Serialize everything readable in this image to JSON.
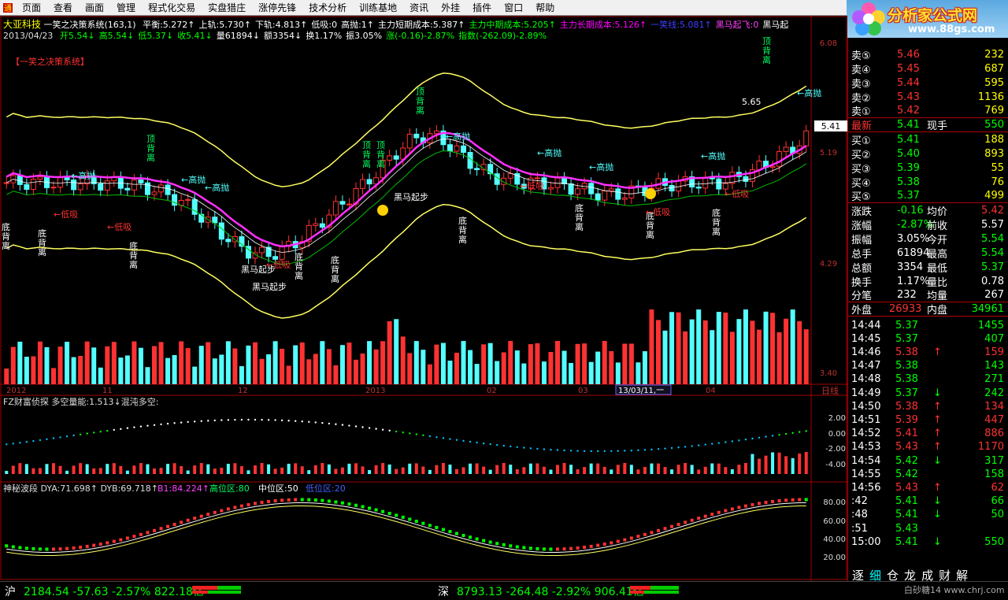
{
  "menu": [
    "页面",
    "查看",
    "画面",
    "管理",
    "程式化交易",
    "实盘猎庄",
    "涨停先锋",
    "技术分析",
    "训练基地",
    "资讯",
    "外挂",
    "插件",
    "窗口",
    "帮助"
  ],
  "banner": {
    "title": "分析家公式网",
    "url": "www.88gs.com"
  },
  "header": {
    "stock_name": "大亚科技",
    "formula": "一笑之决策系统(163,1)",
    "indicators": [
      {
        "text": "平衡:5.272↑",
        "color": "#ffffff"
      },
      {
        "text": "上轨:5.730↑",
        "color": "#ffffff"
      },
      {
        "text": "下轨:4.813↑",
        "color": "#ffffff"
      },
      {
        "text": "低吸:0",
        "color": "#ffffff"
      },
      {
        "text": "高抛:1↑",
        "color": "#ffffff"
      },
      {
        "text": "主力短期成本:5.387↑",
        "color": "#ffffff"
      },
      {
        "text": "主力中期成本:5.205↑",
        "color": "#00ff00"
      },
      {
        "text": "主力长期成本:5.126↑",
        "color": "#ff00ff"
      },
      {
        "text": "一笑线:5.081↑",
        "color": "#4040ff"
      },
      {
        "text": "黑马起飞:0",
        "color": "#ff40ff"
      },
      {
        "text": "黑马起",
        "color": "#ffffff"
      }
    ],
    "date": "2013/04/23",
    "ohlc": [
      {
        "text": "开5.54↓",
        "color": "#00ff00"
      },
      {
        "text": "高5.54↓",
        "color": "#00ff00"
      },
      {
        "text": "低5.37↓",
        "color": "#00ff00"
      },
      {
        "text": "收5.41↓",
        "color": "#00ff00"
      },
      {
        "text": "量61894↓",
        "color": "#ffffff"
      },
      {
        "text": "额3354↓",
        "color": "#ffffff"
      },
      {
        "text": "换1.17%",
        "color": "#ffffff"
      },
      {
        "text": "振3.05%",
        "color": "#ffffff"
      },
      {
        "text": "涨(-0.16)-2.87%",
        "color": "#00ff00"
      },
      {
        "text": "指数(-262.09)-2.89%",
        "color": "#00ff00"
      }
    ],
    "system_tag": "【一笑之决策系统】"
  },
  "axis": {
    "price_ticks": [
      "6.08",
      "5.19",
      "4.29",
      "3.40"
    ],
    "current_price": "5.41",
    "time_labels": [
      "2012",
      "11",
      "12",
      "2013",
      "02",
      "03",
      "13/03/11,一",
      "04"
    ],
    "period_label": "日线",
    "sub1_ticks": [
      "2.00",
      "0.00",
      "-2.00",
      "-4.00"
    ],
    "sub2_ticks": [
      "80.00",
      "60.00",
      "40.00",
      "20.00"
    ]
  },
  "sub1": {
    "title": "FZ财富侦探",
    "text": "多空量能:1.513↓混沌多空:"
  },
  "sub2": {
    "title": "神秘波段",
    "dya": "DYA:71.698↑",
    "dyb": "DYB:69.718↑",
    "b1": "B1:84.224↑",
    "high": "高位区:80",
    "mid": "中位区:50",
    "low": "低位区:20"
  },
  "annotations": {
    "top": "顶背离",
    "bottom": "底背离",
    "sell": "高抛",
    "buy": "低吸",
    "horse": "黑马起步",
    "peak": "5.65"
  },
  "quote": {
    "asks": [
      {
        "label": "卖⑤",
        "price": "5.46",
        "vol": "232"
      },
      {
        "label": "卖④",
        "price": "5.45",
        "vol": "687"
      },
      {
        "label": "卖③",
        "price": "5.44",
        "vol": "595"
      },
      {
        "label": "卖②",
        "price": "5.43",
        "vol": "1136"
      },
      {
        "label": "卖①",
        "price": "5.42",
        "vol": "769"
      }
    ],
    "last": {
      "label": "最新",
      "price": "5.41",
      "mid": "现手",
      "vol": "550"
    },
    "bids": [
      {
        "label": "买①",
        "price": "5.41",
        "vol": "188"
      },
      {
        "label": "买②",
        "price": "5.40",
        "vol": "893"
      },
      {
        "label": "买③",
        "price": "5.39",
        "vol": "55"
      },
      {
        "label": "买④",
        "price": "5.38",
        "vol": "76"
      },
      {
        "label": "买⑤",
        "price": "5.37",
        "vol": "499"
      }
    ],
    "stats": [
      {
        "l1": "涨跌",
        "v1": "-0.16",
        "c1": "#00ff00",
        "l2": "均价",
        "v2": "5.42",
        "c2": "#ff3030"
      },
      {
        "l1": "涨幅",
        "v1": "-2.87%",
        "c1": "#00ff00",
        "l2": "前收",
        "v2": "5.57",
        "c2": "#ffffff"
      },
      {
        "l1": "振幅",
        "v1": "3.05%",
        "c1": "#ffffff",
        "l2": "今开",
        "v2": "5.54",
        "c2": "#00ff00"
      },
      {
        "l1": "总手",
        "v1": "61894",
        "c1": "#ffffff",
        "l2": "最高",
        "v2": "5.54",
        "c2": "#00ff00"
      },
      {
        "l1": "总额",
        "v1": "3354",
        "c1": "#ffffff",
        "l2": "最低",
        "v2": "5.37",
        "c2": "#00ff00"
      },
      {
        "l1": "换手",
        "v1": "1.17%",
        "c1": "#ffffff",
        "l2": "量比",
        "v2": "0.78",
        "c2": "#ffffff"
      },
      {
        "l1": "分笔",
        "v1": "232",
        "c1": "#ffffff",
        "l2": "均量",
        "v2": "267",
        "c2": "#ffffff"
      }
    ],
    "outer": {
      "l1": "外盘",
      "v1": "26933",
      "l2": "内盘",
      "v2": "34961"
    },
    "ticks": [
      {
        "t": "14:44",
        "p": "5.37",
        "d": "",
        "v": "1455"
      },
      {
        "t": "14:45",
        "p": "5.37",
        "d": "",
        "v": "407"
      },
      {
        "t": "14:46",
        "p": "5.38",
        "d": "up",
        "v": "159"
      },
      {
        "t": "14:47",
        "p": "5.38",
        "d": "",
        "v": "143"
      },
      {
        "t": "14:48",
        "p": "5.38",
        "d": "",
        "v": "271"
      },
      {
        "t": "14:49",
        "p": "5.37",
        "d": "down",
        "v": "242"
      },
      {
        "t": "14:50",
        "p": "5.38",
        "d": "up",
        "v": "134"
      },
      {
        "t": "14:51",
        "p": "5.39",
        "d": "up",
        "v": "447"
      },
      {
        "t": "14:52",
        "p": "5.41",
        "d": "up",
        "v": "886"
      },
      {
        "t": "14:53",
        "p": "5.43",
        "d": "up",
        "v": "1170"
      },
      {
        "t": "14:54",
        "p": "5.42",
        "d": "down",
        "v": "317"
      },
      {
        "t": "14:55",
        "p": "5.42",
        "d": "",
        "v": "158"
      },
      {
        "t": "14:56",
        "p": "5.43",
        "d": "up",
        "v": "62"
      },
      {
        "t": ":42",
        "p": "5.41",
        "d": "down",
        "v": "66"
      },
      {
        "t": ":48",
        "p": "5.41",
        "d": "down",
        "v": "50"
      },
      {
        "t": ":51",
        "p": "5.43",
        "d": "",
        "v": ""
      },
      {
        "t": "15:00",
        "p": "5.41",
        "d": "down",
        "v": "550"
      }
    ]
  },
  "tabs": [
    "逐",
    "细",
    "仓",
    "龙",
    "成",
    "财",
    "解"
  ],
  "status": {
    "sh": {
      "label": "沪",
      "value": "2184.54  -57.63  -2.57%  822.18亿"
    },
    "sz": {
      "label": "深",
      "value": "8793.13 -264.48  -2.92%  906.41亿"
    },
    "footer": "白砂糖14  www.chrj.com"
  },
  "colors": {
    "up": "#ff3232",
    "down": "#54ffff",
    "text_green": "#00ff00",
    "yellow": "#ffff00",
    "frame": "#a00000"
  }
}
